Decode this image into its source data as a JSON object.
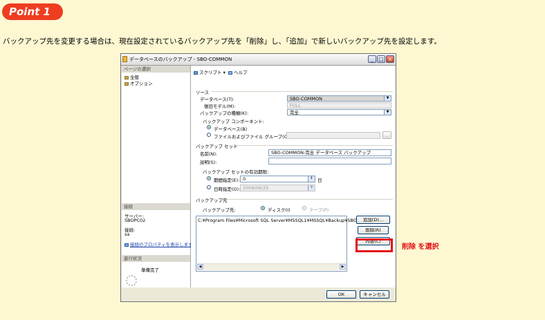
{
  "badge": {
    "label": "Point 1"
  },
  "intro": "バックアップ先を変更する場合は、現在設定されているバックアップ先を「削除」し、「追加」で新しいバックアップ先を設定します。",
  "window": {
    "title": "データベースのバックアップ - SBO-COMMON",
    "minimize": "_",
    "maximize": "□",
    "close": "×"
  },
  "left": {
    "page_select": "ページの選択",
    "items": [
      "全般",
      "オプション"
    ],
    "connection": "接続",
    "server_label": "サーバー:",
    "server_value": "SBOPC02",
    "conn_label": "接続:",
    "conn_value": "sa",
    "link": "接続のプロパティを表示します",
    "progress": "進行状況",
    "status": "準備完了"
  },
  "toolbar": {
    "script": "スクリプト",
    "help": "ヘルプ"
  },
  "source": {
    "group": "ソース",
    "db_label": "データベース(T):",
    "db_value": "SBO-COMMON",
    "model_label": "復旧モデル(M):",
    "model_value": "FULL",
    "type_label": "バックアップの種類(K):",
    "type_value": "完全",
    "component_label": "バックアップ コンポーネント:",
    "opt_database": "データベース(B)",
    "opt_files": "ファイルおよびファイル グループ(G):",
    "browse": "..."
  },
  "backup_set": {
    "group": "バックアップ セット",
    "name_label": "名前(N):",
    "name_value": "SBO-COMMON-完全 データベース バックアップ",
    "desc_label": "説明(S):",
    "desc_value": "",
    "expire_label": "バックアップ セットの有効期限:",
    "after_label": "期間指定(E):",
    "after_value": "0",
    "days": "日",
    "on_label": "日時指定(O):",
    "on_value": "2009/06/25"
  },
  "destination": {
    "group": "バックアップ先",
    "label": "バックアップ先:",
    "disk": "ディスク(I)",
    "tape": "テープ(P)",
    "path": "C:¥Program Files¥Microsoft SQL Server¥MSSQL1¥MSSQL¥Backup¥SBOC",
    "add": "追加(D)...",
    "remove": "削除(R)",
    "contents": "内容(C)"
  },
  "footer": {
    "ok": "OK",
    "cancel": "キャンセル"
  },
  "callout": "削除 を選択"
}
